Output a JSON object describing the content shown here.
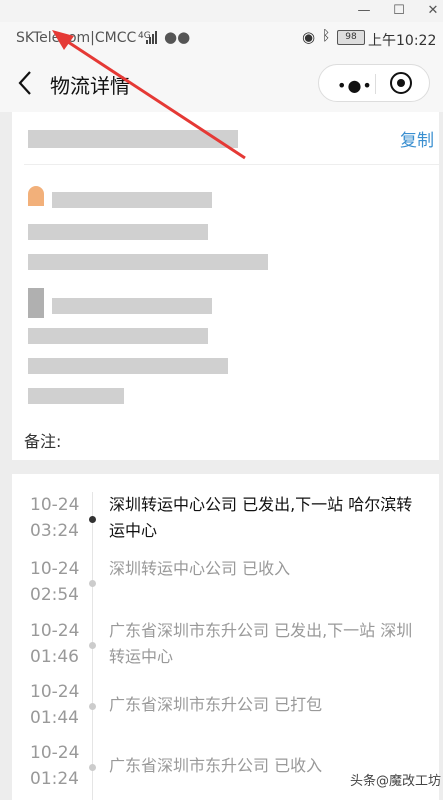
{
  "status": {
    "carrier": "SKTelecom|CMCC",
    "signal_label": "4G",
    "battery": "98",
    "time": "上午10:22"
  },
  "nav": {
    "title": "物流详情"
  },
  "card": {
    "copy_label": "复制",
    "remark_label": "备注:"
  },
  "timeline": [
    {
      "date": "10-24",
      "time": "03:24",
      "text": "深圳转运中心公司 已发出,下一站 哈尔滨转运中心",
      "active": true
    },
    {
      "date": "10-24",
      "time": "02:54",
      "text": "深圳转运中心公司 已收入",
      "active": false
    },
    {
      "date": "10-24",
      "time": "01:46",
      "text": "广东省深圳市东升公司 已发出,下一站 深圳转运中心",
      "active": false
    },
    {
      "date": "10-24",
      "time": "01:44",
      "text": "广东省深圳市东升公司 已打包",
      "active": false
    },
    {
      "date": "10-24",
      "time": "01:24",
      "text": "广东省深圳市东升公司 已收入",
      "active": false
    }
  ],
  "watermark": "头条@魔改工坊",
  "colors": {
    "accent": "#3a8fd0",
    "annotation": "#e53935"
  }
}
